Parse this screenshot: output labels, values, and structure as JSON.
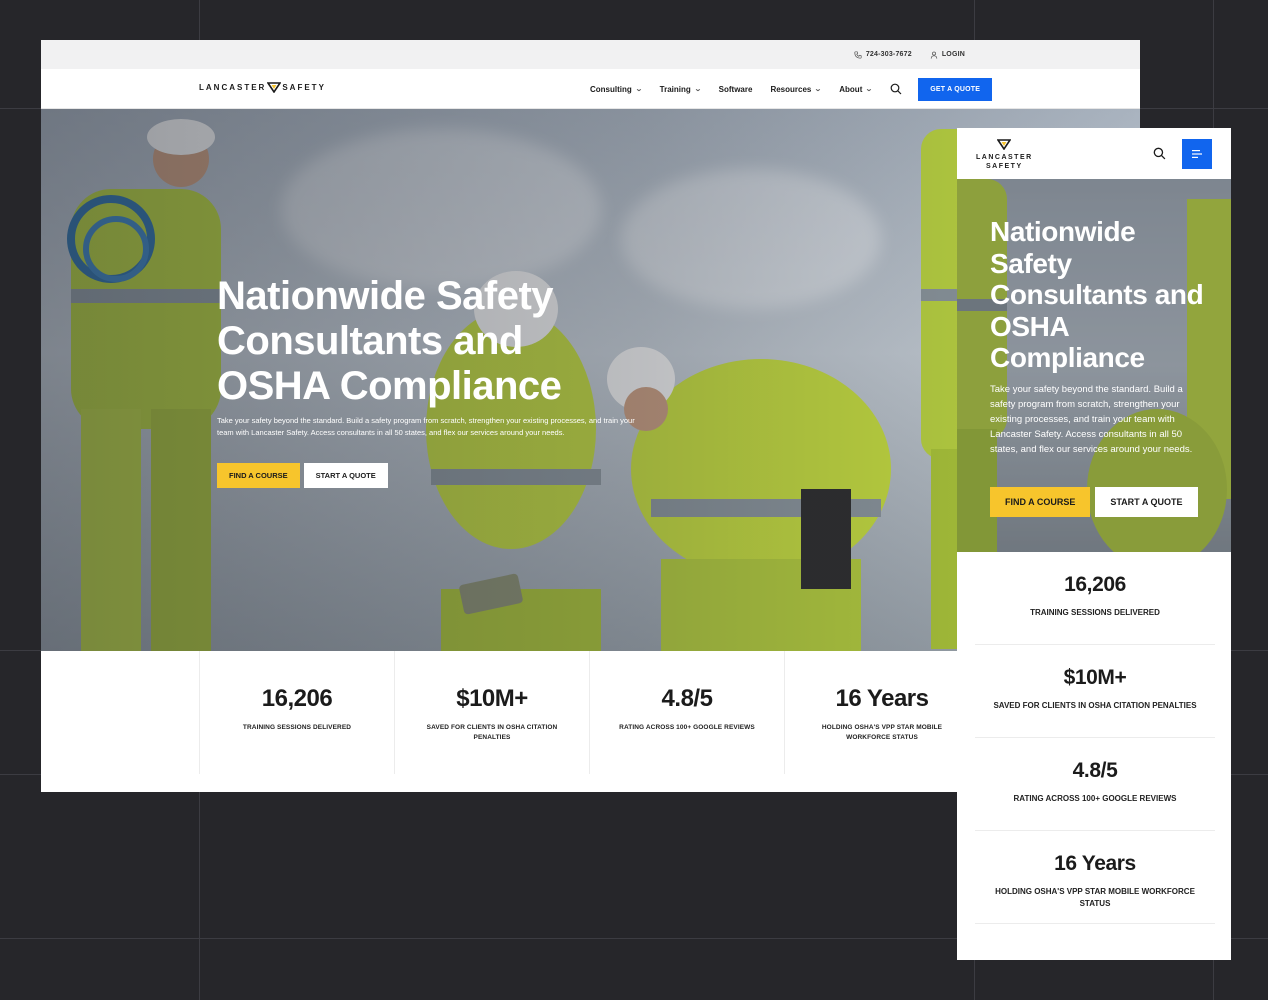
{
  "desktop": {
    "topbar": {
      "phone": "724-303-7672",
      "login": "LOGIN"
    },
    "logo": {
      "left": "LANCASTER",
      "right": "SAFETY"
    },
    "nav": {
      "items": [
        {
          "label": "Consulting",
          "has_dropdown": true
        },
        {
          "label": "Training",
          "has_dropdown": true
        },
        {
          "label": "Software",
          "has_dropdown": false
        },
        {
          "label": "Resources",
          "has_dropdown": true
        },
        {
          "label": "About",
          "has_dropdown": true
        }
      ],
      "quote_button": "GET A QUOTE"
    },
    "hero": {
      "title": "Nationwide Safety Consultants and OSHA Compliance",
      "body": "Take your safety beyond the standard. Build a safety program from scratch, strengthen your existing processes, and train your team with Lancaster Safety. Access consultants in all 50 states, and flex our services around your needs.",
      "primary_button": "FIND A COURSE",
      "secondary_button": "START A QUOTE"
    },
    "stats": [
      {
        "value": "16,206",
        "label": "TRAINING SESSIONS DELIVERED"
      },
      {
        "value": "$10M+",
        "label": "SAVED FOR CLIENTS IN OSHA CITATION PENALTIES"
      },
      {
        "value": "4.8/5",
        "label": "RATING ACROSS 100+ GOOGLE REVIEWS"
      },
      {
        "value": "16 Years",
        "label": "HOLDING OSHA'S VPP STAR MOBILE WORKFORCE STATUS"
      }
    ]
  },
  "mobile": {
    "logo": {
      "line1": "LANCASTER",
      "line2": "SAFETY"
    },
    "hero": {
      "title": "Nationwide Safety Consultants and OSHA Compliance",
      "body": "Take your safety beyond the standard. Build a safety program from scratch, strengthen your existing processes, and train your team with Lancaster Safety. Access consultants in all 50 states, and flex our services around your needs.",
      "primary_button": "FIND A COURSE",
      "secondary_button": "START A QUOTE"
    },
    "stats": [
      {
        "value": "16,206",
        "label": "TRAINING SESSIONS DELIVERED"
      },
      {
        "value": "$10M+",
        "label": "SAVED FOR CLIENTS IN OSHA CITATION PENALTIES"
      },
      {
        "value": "4.8/5",
        "label": "RATING ACROSS 100+ GOOGLE REVIEWS"
      },
      {
        "value": "16 Years",
        "label": "HOLDING OSHA'S VPP STAR MOBILE WORKFORCE STATUS"
      }
    ]
  },
  "colors": {
    "accent_blue": "#1165ee",
    "accent_yellow": "#f7c52c",
    "background": "#26262a",
    "hi_vis": "#c8e03a"
  },
  "icons": {
    "phone": "phone-icon",
    "login": "user-icon",
    "search": "search-icon",
    "menu": "hamburger-menu-icon",
    "dropdown": "chevron-down-icon"
  }
}
